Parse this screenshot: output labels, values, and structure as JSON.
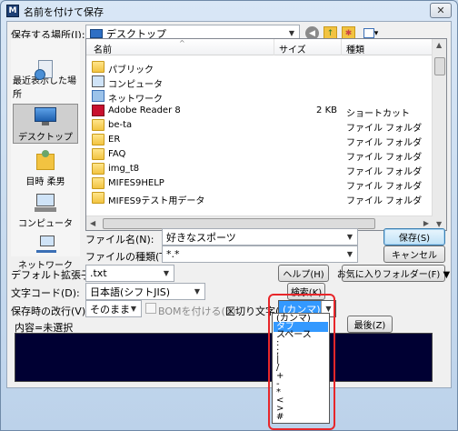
{
  "window": {
    "title": "名前を付けて保存",
    "app_icon": "M"
  },
  "save_location": {
    "label": "保存する場所(I):",
    "value": "デスクトップ"
  },
  "toolbar": {
    "icons": [
      "back-icon",
      "up-folder-icon",
      "new-folder-icon",
      "views-menu-icon"
    ]
  },
  "places": [
    {
      "label": "最近表示した場所",
      "icon": "recent-places-icon"
    },
    {
      "label": "デスクトップ",
      "icon": "desktop-icon"
    },
    {
      "label": "目時 柔男",
      "icon": "user-folder-icon"
    },
    {
      "label": "コンピュータ",
      "icon": "computer-icon"
    },
    {
      "label": "ネットワーク",
      "icon": "network-icon"
    }
  ],
  "columns": {
    "name": "名前",
    "size": "サイズ",
    "type": "種類"
  },
  "files": [
    {
      "name": "パブリック",
      "size": "",
      "type": "",
      "icon": "folder-icon"
    },
    {
      "name": "コンピュータ",
      "size": "",
      "type": "",
      "icon": "computer-icon"
    },
    {
      "name": "ネットワーク",
      "size": "",
      "type": "",
      "icon": "network-icon"
    },
    {
      "name": "Adobe Reader 8",
      "size": "2 KB",
      "type": "ショートカット",
      "icon": "pdf-shortcut-icon"
    },
    {
      "name": "be-ta",
      "size": "",
      "type": "ファイル フォルダ",
      "icon": "folder-icon"
    },
    {
      "name": "ER",
      "size": "",
      "type": "ファイル フォルダ",
      "icon": "folder-icon"
    },
    {
      "name": "FAQ",
      "size": "",
      "type": "ファイル フォルダ",
      "icon": "folder-icon"
    },
    {
      "name": "img_t8",
      "size": "",
      "type": "ファイル フォルダ",
      "icon": "folder-icon"
    },
    {
      "name": "MIFES9HELP",
      "size": "",
      "type": "ファイル フォルダ",
      "icon": "folder-icon"
    },
    {
      "name": "MIFES9テスト用データ",
      "size": "",
      "type": "ファイル フォルダ",
      "icon": "folder-icon"
    }
  ],
  "filename": {
    "label": "ファイル名(N):",
    "value": "好きなスポーツ"
  },
  "filetype": {
    "label": "ファイルの種類(T):",
    "value": "*.*"
  },
  "buttons": {
    "save": "保存(S)",
    "cancel": "キャンセル",
    "help": "ヘルプ(H)",
    "favorites": "お気に入りフォルダー(F) ▼",
    "search": "検索(K)",
    "latest": "最後(Z)"
  },
  "default_ext": {
    "label": "デフォルト拡張子(X):",
    "value": ".txt"
  },
  "char_code": {
    "label": "文字コード(D):",
    "value": "日本語(シフトJIS)"
  },
  "newline": {
    "label": "保存時の改行(V):",
    "value": "そのまま"
  },
  "bom": {
    "label": "BOMを付ける(B)"
  },
  "delimiter": {
    "label": "区切り文字(V):",
    "value": "(カンマ)",
    "options": [
      "(カンマ)",
      "タブ",
      "スペース",
      ":",
      ";",
      "|",
      "/",
      "+",
      "-",
      "*",
      "<",
      ">",
      "#"
    ],
    "selected_index": 1
  },
  "content": {
    "label": "内容=未選択"
  },
  "colors": {
    "highlight": "#e8262a",
    "selection": "#3399ff",
    "content_bg": "#000033"
  }
}
